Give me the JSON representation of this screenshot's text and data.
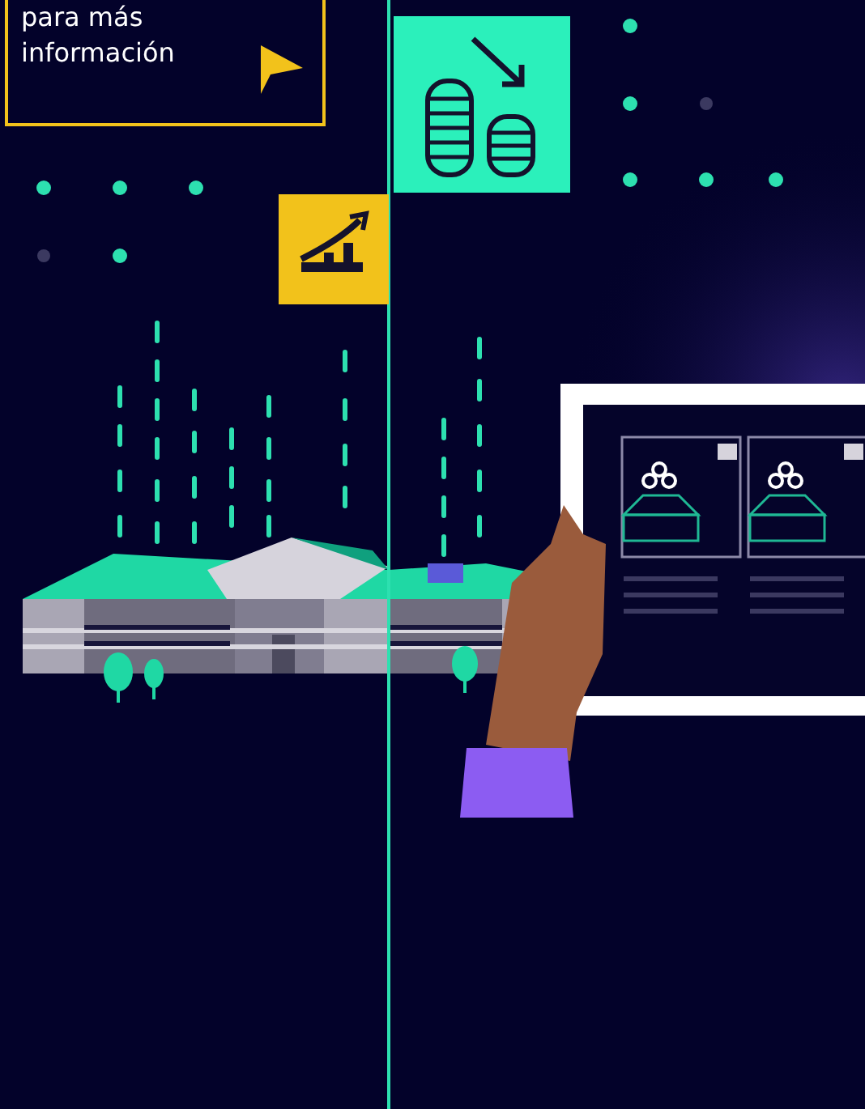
{
  "callout": {
    "text": "para más información"
  }
}
